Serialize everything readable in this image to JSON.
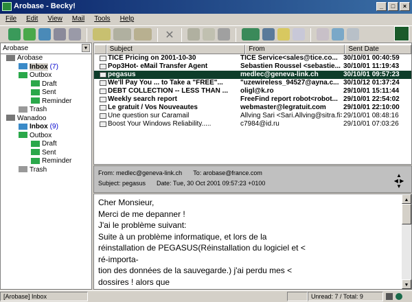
{
  "window": {
    "title": "Arobase - Becky!",
    "buttons": [
      "_",
      "□",
      "×"
    ]
  },
  "menu": [
    "File",
    "Edit",
    "View",
    "Mail",
    "Tools",
    "Help"
  ],
  "folders": {
    "combo": "Arobase",
    "tree": [
      {
        "label": "Arobase",
        "level": 0,
        "type": "account"
      },
      {
        "label": "Inbox",
        "count": "(7)",
        "level": 1,
        "type": "inbox",
        "bold": true
      },
      {
        "label": "Outbox",
        "level": 1,
        "type": "folder"
      },
      {
        "label": "Draft",
        "level": 2,
        "type": "folder"
      },
      {
        "label": "Sent",
        "level": 2,
        "type": "folder"
      },
      {
        "label": "Reminder",
        "level": 2,
        "type": "folder"
      },
      {
        "label": "Trash",
        "level": 1,
        "type": "trash"
      },
      {
        "label": "Wanadoo",
        "level": 0,
        "type": "account"
      },
      {
        "label": "Inbox",
        "count": "(9)",
        "level": 1,
        "type": "inbox",
        "bold": true
      },
      {
        "label": "Outbox",
        "level": 1,
        "type": "folder"
      },
      {
        "label": "Draft",
        "level": 2,
        "type": "folder"
      },
      {
        "label": "Sent",
        "level": 2,
        "type": "folder"
      },
      {
        "label": "Reminder",
        "level": 2,
        "type": "folder"
      },
      {
        "label": "Trash",
        "level": 1,
        "type": "trash"
      }
    ]
  },
  "list": {
    "columns": [
      "",
      "Subject",
      "From",
      "Sent Date"
    ],
    "rows": [
      {
        "subject": "TICE Pricing on 2001-10-30",
        "from": "TICE Service<sales@tice.co...",
        "date": "30/10/01 00:40:59",
        "bold": true
      },
      {
        "subject": "Pop3Hot- eMail Transfer Agent",
        "from": "Sebastien Roussel <sebastie...",
        "date": "30/10/01 11:19:43",
        "bold": true
      },
      {
        "subject": "pegasus",
        "from": "medlec@geneva-link.ch",
        "date": "30/10/01 09:57:23",
        "bold": true,
        "selected": true
      },
      {
        "subject": "We'll Pay You ... to Take a \"FREE\"...",
        "from": "\"uzewireless_94527@ayna.c...",
        "date": "30/10/12 01:37:24",
        "bold": true
      },
      {
        "subject": "DEBT COLLECTION -- LESS THAN ...",
        "from": "oligl@k.ro",
        "date": "29/10/01 15:11:44",
        "bold": true
      },
      {
        "subject": "Weekly search report",
        "from": "FreeFind report robot<robot...",
        "date": "29/10/01 22:54:02",
        "bold": true
      },
      {
        "subject": "Le gratuit / Vos Nouveautes",
        "from": "webmaster@legratuit.com",
        "date": "29/10/01 22:10:00",
        "bold": true
      },
      {
        "subject": "Une question sur Caramail",
        "from": "Allving Sari <Sari.Allving@sitra.fi>",
        "date": "29/10/01 08:48:16",
        "bold": false
      },
      {
        "subject": "Boost Your Windows Reliability.....",
        "from": "c7984@id.ru",
        "date": "29/10/01 07:03:26",
        "bold": false
      }
    ]
  },
  "preview": {
    "from": "From: medlec@geneva-link.ch",
    "to": "To: arobase@france.com",
    "subject": "Subject: pegasus",
    "date": "Date: Tue, 30 Oct 2001 09:57:23 +0100",
    "body": [
      "Cher Monsieur,",
      "Merci de me depanner !",
      "J'ai le problème suivant:",
      "Suite à un problème informatique, et lors de la",
      "réinstallation de PEGASUS(Réinstallation du logiciel et <",
      "ré-importa-",
      "tion des données de la sauvegarde.) j'ai perdu mes <",
      "dossires ! alors que"
    ]
  },
  "status": {
    "folder": "[Arobase] Inbox",
    "counts": "Unread:   7 / Total:   9"
  }
}
